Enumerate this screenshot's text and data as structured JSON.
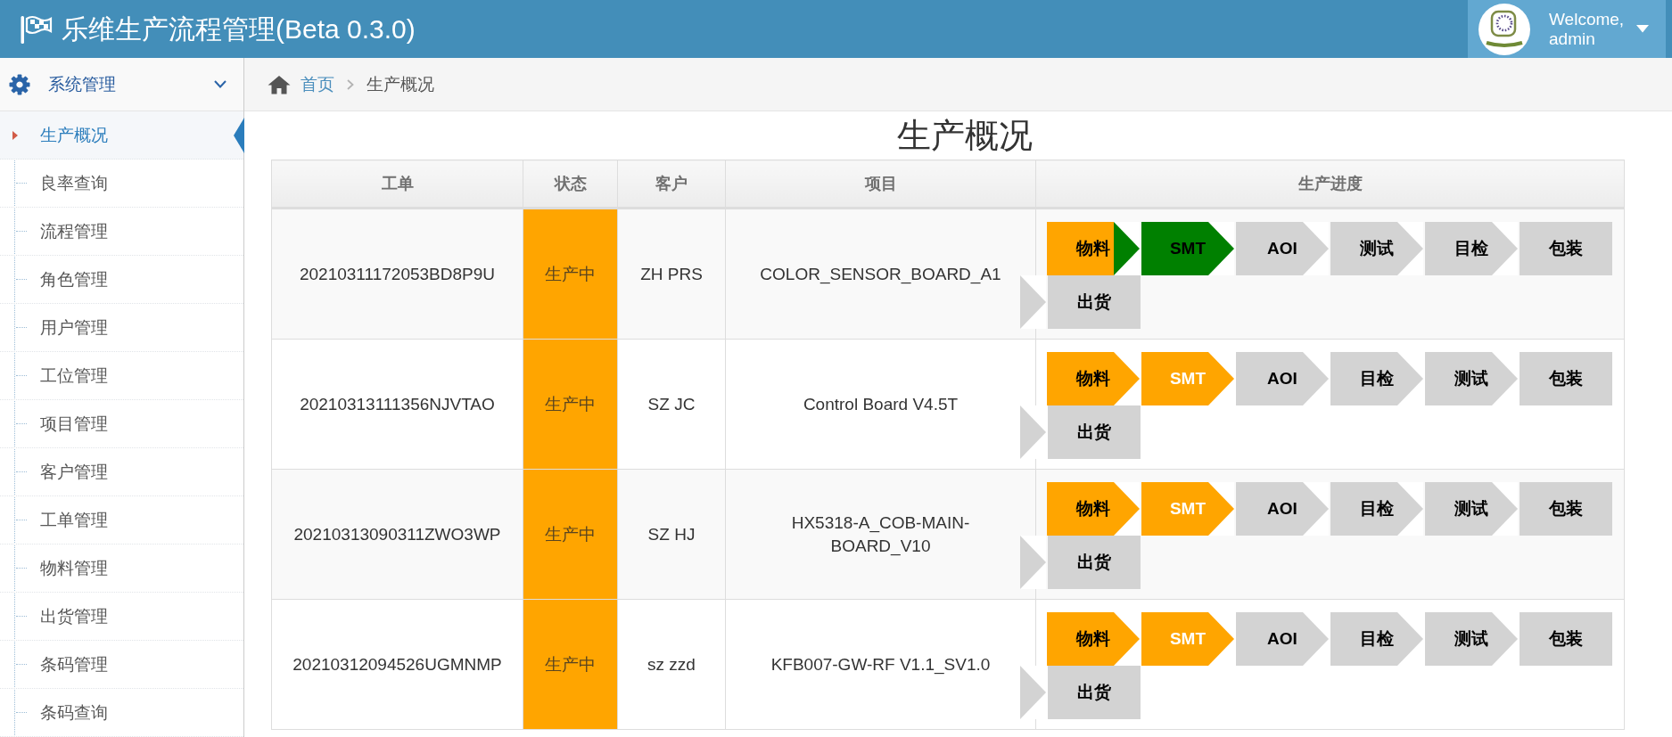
{
  "header": {
    "title": "乐维生产流程管理(Beta 0.3.0)",
    "user": {
      "greeting": "Welcome,",
      "name": "admin"
    }
  },
  "sidebar": {
    "group": {
      "label": "系统管理",
      "expanded": true
    },
    "items": [
      {
        "label": "生产概况",
        "selected": true
      },
      {
        "label": "良率查询",
        "selected": false
      },
      {
        "label": "流程管理",
        "selected": false
      },
      {
        "label": "角色管理",
        "selected": false
      },
      {
        "label": "用户管理",
        "selected": false
      },
      {
        "label": "工位管理",
        "selected": false
      },
      {
        "label": "项目管理",
        "selected": false
      },
      {
        "label": "客户管理",
        "selected": false
      },
      {
        "label": "工单管理",
        "selected": false
      },
      {
        "label": "物料管理",
        "selected": false
      },
      {
        "label": "出货管理",
        "selected": false
      },
      {
        "label": "条码管理",
        "selected": false
      },
      {
        "label": "条码查询",
        "selected": false
      }
    ]
  },
  "breadcrumb": [
    {
      "label": "首页",
      "kind": "link"
    },
    {
      "label": "生产概况",
      "kind": "current"
    }
  ],
  "page_title": "生产概况",
  "table": {
    "columns": [
      "工单",
      "状态",
      "客户",
      "项目",
      "生产进度"
    ],
    "rows": [
      {
        "work_order": "20210311172053BD8P9U",
        "status": "生产中",
        "customer": "ZH PRS",
        "project": "COLOR_SENSOR_BOARD_A1",
        "progress": [
          {
            "kind": "step",
            "label": "物料",
            "color": "#ffa500",
            "active": false
          },
          {
            "kind": "arrow",
            "color": "#008000"
          },
          {
            "kind": "step",
            "label": "SMT",
            "color": "#008000",
            "active": false
          },
          {
            "kind": "arrow",
            "color": "#008000"
          },
          {
            "kind": "step",
            "label": "AOI",
            "color": "#d3d3d3",
            "active": false
          },
          {
            "kind": "arrow",
            "color": "#d3d3d3"
          },
          {
            "kind": "step",
            "label": "测试",
            "color": "#d3d3d3",
            "active": false
          },
          {
            "kind": "arrow",
            "color": "#d3d3d3"
          },
          {
            "kind": "step",
            "label": "目检",
            "color": "#d3d3d3",
            "active": false
          },
          {
            "kind": "arrow",
            "color": "#d3d3d3"
          },
          {
            "kind": "step",
            "label": "包装",
            "color": "#d3d3d3",
            "active": false
          },
          {
            "kind": "arrow",
            "color": "#d3d3d3"
          },
          {
            "kind": "step",
            "label": "出货",
            "color": "#d3d3d3",
            "active": false
          }
        ]
      },
      {
        "work_order": "20210313111356NJVTAO",
        "status": "生产中",
        "customer": "SZ JC",
        "project": "Control Board V4.5T",
        "progress": [
          {
            "kind": "step",
            "label": "物料",
            "color": "#ffa500",
            "active": false
          },
          {
            "kind": "arrow",
            "color": "#ffa500"
          },
          {
            "kind": "step",
            "label": "SMT",
            "color": "#ffa500",
            "active": true
          },
          {
            "kind": "arrow",
            "color": "#ffa500"
          },
          {
            "kind": "step",
            "label": "AOI",
            "color": "#d3d3d3",
            "active": false
          },
          {
            "kind": "arrow",
            "color": "#d3d3d3"
          },
          {
            "kind": "step",
            "label": "目检",
            "color": "#d3d3d3",
            "active": false
          },
          {
            "kind": "arrow",
            "color": "#d3d3d3"
          },
          {
            "kind": "step",
            "label": "测试",
            "color": "#d3d3d3",
            "active": false
          },
          {
            "kind": "arrow",
            "color": "#d3d3d3"
          },
          {
            "kind": "step",
            "label": "包装",
            "color": "#d3d3d3",
            "active": false
          },
          {
            "kind": "arrow",
            "color": "#d3d3d3"
          },
          {
            "kind": "step",
            "label": "出货",
            "color": "#d3d3d3",
            "active": false
          }
        ]
      },
      {
        "work_order": "20210313090311ZWO3WP",
        "status": "生产中",
        "customer": "SZ HJ",
        "project": "HX5318-A_COB-MAIN-BOARD_V10",
        "progress": [
          {
            "kind": "step",
            "label": "物料",
            "color": "#ffa500",
            "active": false
          },
          {
            "kind": "arrow",
            "color": "#ffa500"
          },
          {
            "kind": "step",
            "label": "SMT",
            "color": "#ffa500",
            "active": true
          },
          {
            "kind": "arrow",
            "color": "#ffa500"
          },
          {
            "kind": "step",
            "label": "AOI",
            "color": "#d3d3d3",
            "active": false
          },
          {
            "kind": "arrow",
            "color": "#d3d3d3"
          },
          {
            "kind": "step",
            "label": "目检",
            "color": "#d3d3d3",
            "active": false
          },
          {
            "kind": "arrow",
            "color": "#d3d3d3"
          },
          {
            "kind": "step",
            "label": "测试",
            "color": "#d3d3d3",
            "active": false
          },
          {
            "kind": "arrow",
            "color": "#d3d3d3"
          },
          {
            "kind": "step",
            "label": "包装",
            "color": "#d3d3d3",
            "active": false
          },
          {
            "kind": "arrow",
            "color": "#d3d3d3"
          },
          {
            "kind": "step",
            "label": "出货",
            "color": "#d3d3d3",
            "active": false
          }
        ]
      },
      {
        "work_order": "20210312094526UGMNMP",
        "status": "生产中",
        "customer": "sz zzd",
        "project": "KFB007-GW-RF V1.1_SV1.0",
        "progress": [
          {
            "kind": "step",
            "label": "物料",
            "color": "#ffa500",
            "active": false
          },
          {
            "kind": "arrow",
            "color": "#ffa500"
          },
          {
            "kind": "step",
            "label": "SMT",
            "color": "#ffa500",
            "active": true
          },
          {
            "kind": "arrow",
            "color": "#ffa500"
          },
          {
            "kind": "step",
            "label": "AOI",
            "color": "#d3d3d3",
            "active": false
          },
          {
            "kind": "arrow",
            "color": "#d3d3d3"
          },
          {
            "kind": "step",
            "label": "目检",
            "color": "#d3d3d3",
            "active": false
          },
          {
            "kind": "arrow",
            "color": "#d3d3d3"
          },
          {
            "kind": "step",
            "label": "测试",
            "color": "#d3d3d3",
            "active": false
          },
          {
            "kind": "arrow",
            "color": "#d3d3d3"
          },
          {
            "kind": "step",
            "label": "包装",
            "color": "#d3d3d3",
            "active": false
          },
          {
            "kind": "arrow",
            "color": "#d3d3d3"
          },
          {
            "kind": "step",
            "label": "出货",
            "color": "#d3d3d3",
            "active": false
          }
        ]
      }
    ]
  }
}
